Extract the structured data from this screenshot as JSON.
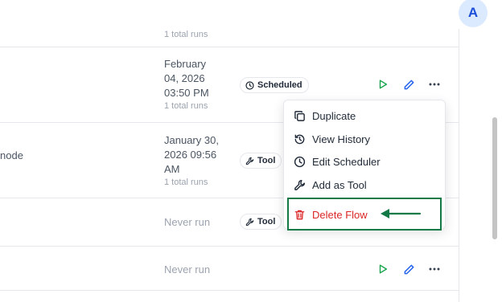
{
  "user": {
    "avatar_initial": "A"
  },
  "rows": [
    {
      "runs": "1 total runs"
    },
    {
      "date": "February 04, 2026 03:50 PM",
      "runs": "1 total runs",
      "badge": "Scheduled",
      "badge_icon": "clock-icon"
    },
    {
      "name_fragment": "node",
      "date": "January 30, 2026 09:56 AM",
      "runs": "1 total runs",
      "badge": "Tool",
      "badge_icon": "wrench-icon"
    },
    {
      "date": "Never run",
      "badge": "Tool",
      "badge_icon": "wrench-icon"
    },
    {
      "date": "Never run"
    }
  ],
  "menu": {
    "items": [
      {
        "label": "Duplicate",
        "icon": "copy-icon"
      },
      {
        "label": "View History",
        "icon": "history-icon"
      },
      {
        "label": "Edit Scheduler",
        "icon": "clock-icon"
      },
      {
        "label": "Add as Tool",
        "icon": "wrench-icon"
      },
      {
        "label": "Delete Flow",
        "icon": "trash-icon",
        "color": "#dc2626"
      }
    ]
  },
  "colors": {
    "run": "#16a34a",
    "edit": "#2563eb",
    "danger": "#dc2626",
    "highlight": "#137a47"
  }
}
